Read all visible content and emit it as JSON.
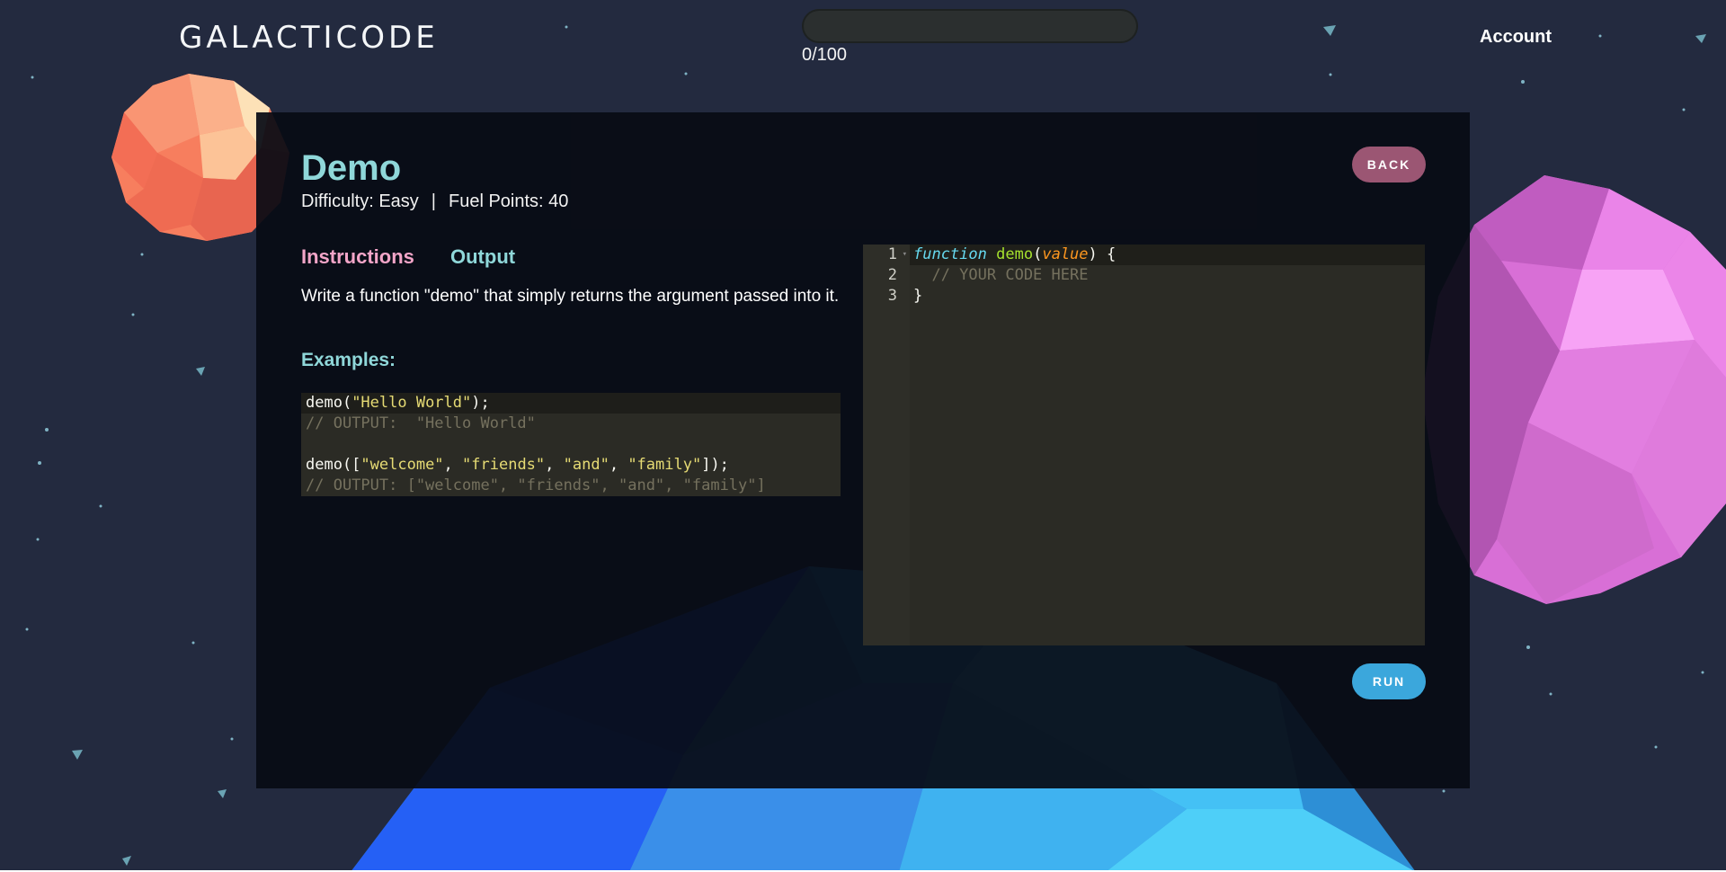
{
  "header": {
    "logo": "GALACTICODE",
    "progress": {
      "label": "0/100",
      "fraction": 0.0
    },
    "account_label": "Account"
  },
  "challenge": {
    "title": "Demo",
    "difficulty": "Difficulty: Easy",
    "separator": "|",
    "fuel_points": "Fuel Points: 40",
    "back_label": "BACK",
    "tabs": [
      "Instructions",
      "Output"
    ],
    "instructions": "Write a function \"demo\" that simply returns the argument passed into it.",
    "examples_heading": "Examples:",
    "examples": {
      "call1_fn": "demo(",
      "call1_arg": "\"Hello World\"",
      "call1_end": ");",
      "output1": "// OUTPUT:  \"Hello World\"",
      "call2_fn": "demo([",
      "call2_a": "\"welcome\"",
      "call2_b": "\"friends\"",
      "call2_c": "\"and\"",
      "call2_d": "\"family\"",
      "call2_sep": ", ",
      "call2_end": "]);",
      "output2": "// OUTPUT: [\"welcome\", \"friends\", \"and\", \"family\"]"
    },
    "run_label": "RUN"
  },
  "editor": {
    "line_numbers": [
      "1",
      "2",
      "3"
    ],
    "keyword": "function",
    "function_name": "demo",
    "open_paren": "(",
    "param": "value",
    "close_sig": ") {",
    "comment": "  // YOUR CODE HERE",
    "closing_brace": "}"
  },
  "colors": {
    "title_teal": "#8fd7d9",
    "tab_pink": "#f3a5c8",
    "back_button": "#9b5673",
    "run_button": "#3ba7dc",
    "editor_bg": "#2b2b25"
  }
}
